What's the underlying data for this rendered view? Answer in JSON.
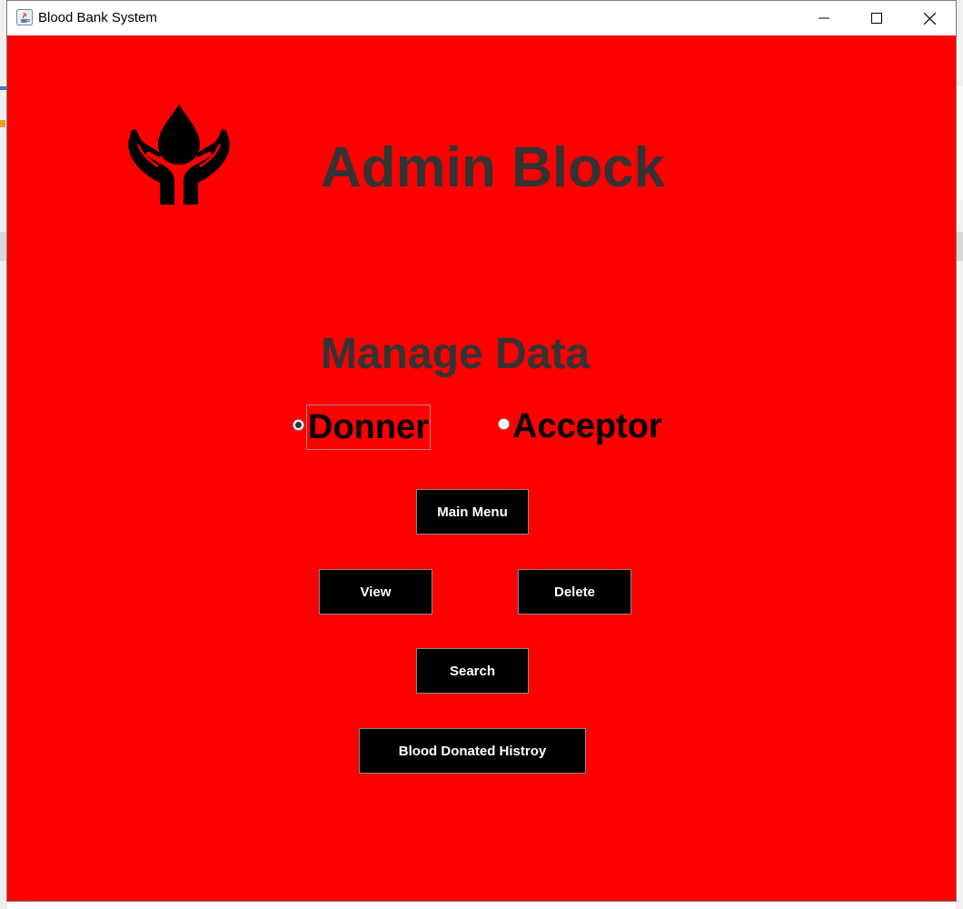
{
  "window": {
    "title": "Blood Bank System",
    "controls": {
      "minimize": "minimize",
      "maximize": "maximize",
      "close": "close"
    }
  },
  "colors": {
    "background": "#ff0000",
    "heading": "#333333",
    "button_bg": "#000000",
    "button_text": "#ffffff"
  },
  "logo": {
    "icon": "blood-drop-hands-icon"
  },
  "headings": {
    "admin": "Admin Block",
    "manage": "Manage Data"
  },
  "radios": {
    "donner": {
      "label": "Donner",
      "selected": true
    },
    "acceptor": {
      "label": "Acceptor",
      "selected": false
    }
  },
  "buttons": {
    "main_menu": "Main Menu",
    "view": "View",
    "delete": "Delete",
    "search": "Search",
    "history": "Blood Donated Histroy"
  }
}
